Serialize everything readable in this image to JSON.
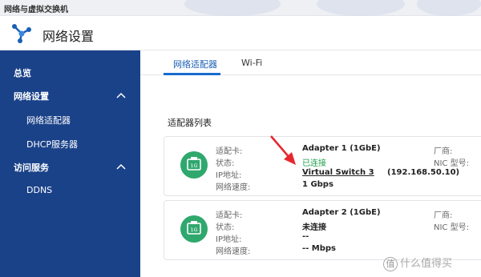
{
  "window": {
    "title": "网络与虚拟交换机"
  },
  "header": {
    "title": "网络设置"
  },
  "sidebar": {
    "items": [
      {
        "label": "总览"
      },
      {
        "label": "网络设置"
      },
      {
        "label": "网络适配器"
      },
      {
        "label": "DHCP服务器"
      },
      {
        "label": "访问服务"
      },
      {
        "label": "DDNS"
      }
    ]
  },
  "tabs": [
    {
      "label": "网络适配器"
    },
    {
      "label": "Wi-Fi"
    }
  ],
  "section": {
    "title": "适配器列表"
  },
  "adapters": [
    {
      "port_label": "1G",
      "labels": {
        "card": "适配卡:",
        "status": "状态:",
        "ip": "IP地址:",
        "speed": "网络速度:",
        "vendor": "厂商:",
        "nic": "NIC 型号:"
      },
      "name": "Adapter 1 (1GbE)",
      "status": "已连接",
      "switch": "Virtual Switch 3",
      "ip": "(192.168.50.10)",
      "speed": "1 Gbps"
    },
    {
      "port_label": "1G",
      "labels": {
        "card": "适配卡:",
        "status": "状态:",
        "ip": "IP地址:",
        "speed": "网络速度:",
        "vendor": "厂商:",
        "nic": "NIC 型号:"
      },
      "name": "Adapter 2 (1GbE)",
      "status": "未连接",
      "ip": "--",
      "speed": "-- Mbps"
    }
  ],
  "watermark": {
    "text": "什么值得买",
    "logo_char": "值"
  },
  "colors": {
    "sidebar": "#1a4289",
    "accent": "#1a6bd0",
    "port_green": "#2fa86e",
    "connected": "#1e9e4a",
    "arrow": "#e8262e"
  }
}
